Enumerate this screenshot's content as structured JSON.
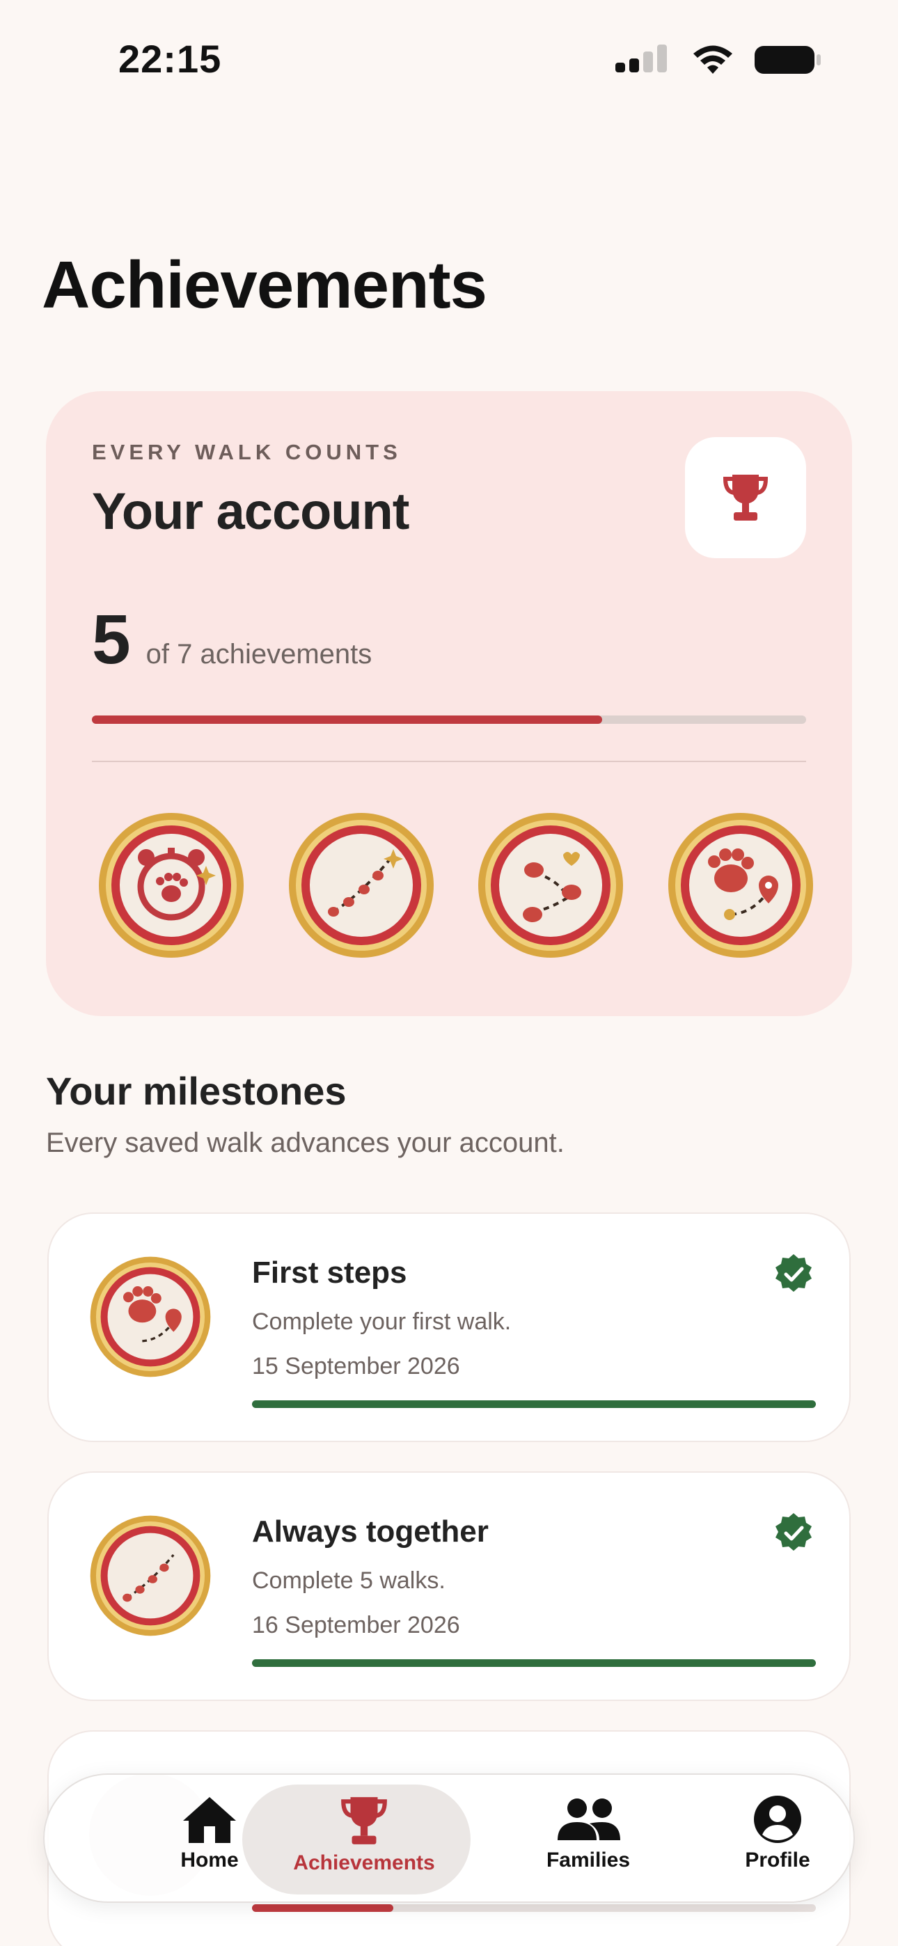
{
  "status_bar": {
    "time": "22:15"
  },
  "page_title": "Achievements",
  "account": {
    "eyebrow": "EVERY WALK COUNTS",
    "title": "Your account",
    "earned": "5",
    "earned_suffix": "of 7 achievements",
    "progress_fraction": 0.714,
    "badges": [
      "alarm-clock-paw-badge",
      "paw-trail-badge",
      "paws-heart-badge",
      "paw-route-pin-badge"
    ]
  },
  "milestones_section": {
    "title": "Your milestones",
    "subtitle": "Every saved walk advances your account."
  },
  "milestones": [
    {
      "title": "First steps",
      "description": "Complete your first walk.",
      "date": "15 September 2026",
      "progress_fraction": 1.0,
      "completed": true
    },
    {
      "title": "Always together",
      "description": "Complete 5 walks.",
      "date": "16 September 2026",
      "progress_fraction": 1.0,
      "completed": true
    }
  ],
  "tab_bar": {
    "home": "Home",
    "achievements": "Achievements",
    "families": "Families",
    "profile": "Profile",
    "active": "achievements"
  },
  "colors": {
    "accent_red": "#bf3a3f",
    "success_green": "#2f6e3d",
    "card_pink": "#fbe6e4",
    "gold": "#d9a640"
  }
}
